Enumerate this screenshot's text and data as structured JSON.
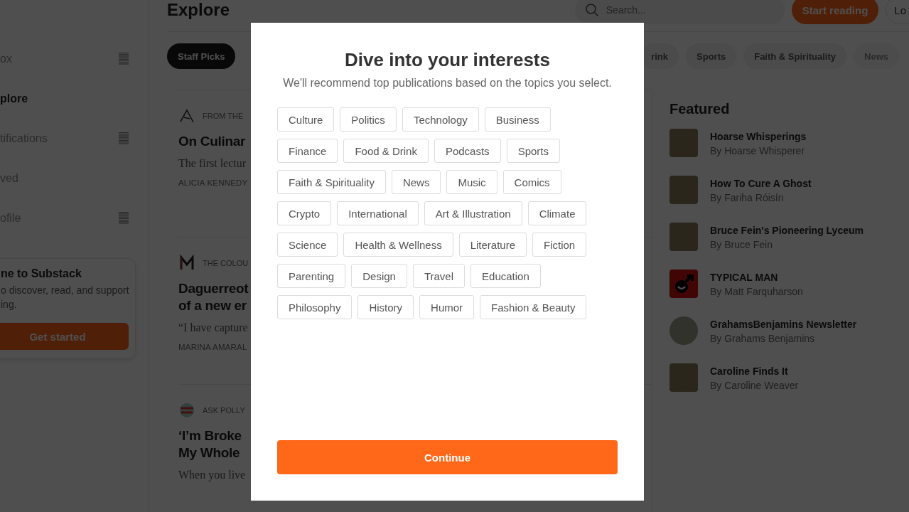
{
  "sidebar": {
    "items": [
      {
        "label": "ox",
        "selected": false,
        "icon": true
      },
      {
        "label": "plore",
        "selected": true,
        "icon": false
      },
      {
        "label": "tifications",
        "selected": false,
        "icon": true
      },
      {
        "label": "ved",
        "selected": false,
        "icon": false
      },
      {
        "label": "ofile",
        "selected": false,
        "icon": true
      }
    ],
    "promo": {
      "title": "ne to Substack",
      "text": "o discover, read, and support",
      "text_2": "ing.",
      "button": "Get started"
    }
  },
  "header": {
    "title": "Explore",
    "search": {
      "placeholder": "Search..."
    },
    "start_button": "Start reading",
    "login_button": "Lo"
  },
  "categories": [
    {
      "label": "Staff Picks",
      "selected": true
    },
    {
      "label": "rink",
      "selected": false
    },
    {
      "label": "Sports",
      "selected": false
    },
    {
      "label": "Faith & Spirituality",
      "selected": false
    },
    {
      "label": "News",
      "selected": false
    }
  ],
  "feed": [
    {
      "kind": "pen",
      "publication": "FROM THE",
      "title": [
        "On Culinar"
      ],
      "excerpt": "The first lectur",
      "author": "ALICIA KENNEDY"
    },
    {
      "kind": "letter",
      "publication": "THE COLOU",
      "title": [
        "Daguerreot",
        "of a new er"
      ],
      "excerpt": "“I have capture",
      "author": "MARINA AMARAL"
    },
    {
      "kind": "badge",
      "publication": "ASK POLLY",
      "title": [
        "‘I’m Broke",
        "My Whole"
      ],
      "excerpt": "When you live"
    }
  ],
  "featured": {
    "title": "Featured",
    "items": [
      {
        "kind": "photo",
        "name": "Hoarse Whisperings",
        "author": "By Hoarse Whisperer"
      },
      {
        "kind": "photo",
        "name": "How To Cure A Ghost",
        "author": "By Fariha Róisín"
      },
      {
        "kind": "photo",
        "name": "Bruce Fein's Pioneering Lyceum",
        "author": "By Bruce Fein"
      },
      {
        "kind": "logo",
        "name": "TYPICAL MAN",
        "author": "By Matt Farquharson"
      },
      {
        "kind": "round",
        "name": "GrahamsBenjamins Newsletter",
        "author": "By Grahams Benjamins"
      },
      {
        "kind": "photo",
        "name": "Caroline Finds It",
        "author": "By Caroline Weaver"
      }
    ]
  },
  "modal": {
    "title": "Dive into your interests",
    "subtitle": "We'll recommend top publications based on the topics you select.",
    "topics": [
      {
        "label": "Culture",
        "selected": false
      },
      {
        "label": "Politics",
        "selected": false
      },
      {
        "label": "Technology",
        "selected": false
      },
      {
        "label": "Business",
        "selected": false
      },
      {
        "label": "Finance",
        "selected": false
      },
      {
        "label": "Food & Drink",
        "selected": false
      },
      {
        "label": "Podcasts",
        "selected": false
      },
      {
        "label": "Sports",
        "selected": false
      },
      {
        "label": "Faith & Spirituality",
        "selected": false
      },
      {
        "label": "News",
        "selected": false
      },
      {
        "label": "Music",
        "selected": false
      },
      {
        "label": "Comics",
        "selected": false
      },
      {
        "label": "Crypto",
        "selected": false
      },
      {
        "label": "International",
        "selected": false
      },
      {
        "label": "Art & Illustration",
        "selected": false
      },
      {
        "label": "Climate",
        "selected": false
      },
      {
        "label": "Science",
        "selected": false
      },
      {
        "label": "Health & Wellness",
        "selected": false
      },
      {
        "label": "Literature",
        "selected": false
      },
      {
        "label": "Fiction",
        "selected": false
      },
      {
        "label": "Parenting",
        "selected": false
      },
      {
        "label": "Design",
        "selected": false
      },
      {
        "label": "Travel",
        "selected": false
      },
      {
        "label": "Education",
        "selected": false
      },
      {
        "label": "Philosophy",
        "selected": false
      },
      {
        "label": "History",
        "selected": false
      },
      {
        "label": "Humor",
        "selected": false
      },
      {
        "label": "Fashion & Beauty",
        "selected": false
      }
    ],
    "continue_button": "Continue"
  }
}
